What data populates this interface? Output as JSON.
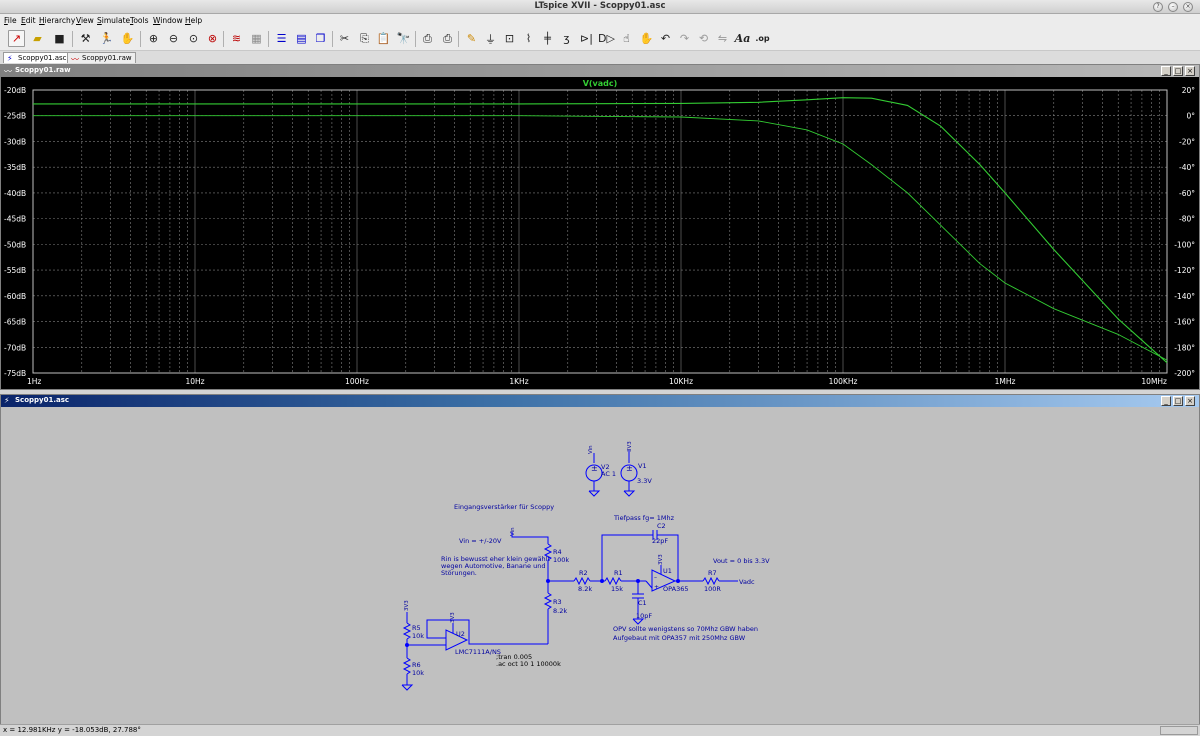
{
  "window": {
    "title": "LTspice XVII - Scoppy01.asc"
  },
  "menu": [
    "File",
    "Edit",
    "Hierarchy",
    "View",
    "Simulate",
    "Tools",
    "Window",
    "Help"
  ],
  "toolbar_icons": [
    "new-schematic-icon",
    "open-icon",
    "save-icon",
    "control-panel-icon",
    "run-icon",
    "halt-icon",
    "zoom-in-icon",
    "zoom-out-icon",
    "pan-icon",
    "zoom-fit-icon",
    "autorange-icon",
    "undo-zoom-icon",
    "tile-horizontal-icon",
    "tile-vertical-icon",
    "cascade-icon",
    "cut-icon",
    "copy-icon",
    "paste-icon",
    "find-icon",
    "print-icon",
    "print-setup-icon",
    "pencil-icon",
    "ground-icon",
    "label-net-icon",
    "resistor-icon",
    "capacitor-icon",
    "inductor-icon",
    "diode-icon",
    "component-icon",
    "move-icon",
    "drag-icon",
    "undo-icon",
    "redo-icon",
    "rotate-icon",
    "mirror-icon",
    "text-icon",
    "spice-directive-icon"
  ],
  "tabs": [
    {
      "label": "Scoppy01.asc",
      "icon": "schematic-icon"
    },
    {
      "label": "Scoppy01.raw",
      "icon": "waveform-icon"
    }
  ],
  "plot_window": {
    "title": "Scoppy01.raw"
  },
  "schematic_window": {
    "title": "Scoppy01.asc"
  },
  "status": {
    "text": "x = 12.981KHz   y = -18.053dB, 27.788°"
  },
  "colors": {
    "trace": "#33cc33",
    "plot_bg": "#000000",
    "grid": "#808080",
    "wire": "#0000ff",
    "text": "#0000a0",
    "schematic_bg": "#c0c0c0"
  },
  "chart_data": {
    "type": "line",
    "title": "V(vadc)",
    "x_scale": "log",
    "xlim": [
      1,
      10000000
    ],
    "x_ticks": [
      "1Hz",
      "10Hz",
      "100Hz",
      "1KHz",
      "10KHz",
      "100KHz",
      "1MHz",
      "10MHz"
    ],
    "y_left": {
      "label": "dB",
      "ylim": [
        -75,
        -20
      ],
      "ticks": [
        "-20dB",
        "-25dB",
        "-30dB",
        "-35dB",
        "-40dB",
        "-45dB",
        "-50dB",
        "-55dB",
        "-60dB",
        "-65dB",
        "-70dB",
        "-75dB"
      ]
    },
    "y_right": {
      "label": "°",
      "ylim": [
        -200,
        20
      ],
      "ticks": [
        "20°",
        "0°",
        "-20°",
        "-40°",
        "-60°",
        "-80°",
        "-100°",
        "-120°",
        "-140°",
        "-160°",
        "-180°",
        "-200°"
      ]
    },
    "grid": true,
    "series": [
      {
        "name": "V(vadc)",
        "axis": "left",
        "quantity": "magnitude (dB)",
        "x": [
          1,
          10,
          100,
          1000,
          10000,
          30000,
          60000,
          100000,
          150000,
          250000,
          400000,
          700000,
          1000000,
          2000000,
          5000000,
          10000000
        ],
        "y": [
          -22.7,
          -22.7,
          -22.7,
          -22.7,
          -22.6,
          -22.4,
          -21.9,
          -21.5,
          -21.6,
          -23.0,
          -27.0,
          -34.5,
          -40.0,
          -51.0,
          -64.5,
          -73.0
        ]
      },
      {
        "name": "V(vadc)",
        "axis": "right",
        "quantity": "phase (°)",
        "x": [
          1,
          10,
          100,
          1000,
          10000,
          30000,
          60000,
          100000,
          150000,
          250000,
          400000,
          700000,
          1000000,
          2000000,
          5000000,
          10000000
        ],
        "y": [
          0,
          0,
          0,
          0,
          -1,
          -4,
          -11,
          -22,
          -38,
          -60,
          -85,
          -115,
          -130,
          -150,
          -170,
          -190
        ]
      }
    ]
  },
  "schematic": {
    "labels": {
      "v2_name": "V2",
      "v2_value": "AC 1",
      "v1_name": "V1",
      "v1_value": "3.3V",
      "vin_net": "Vin",
      "v3_net": "3V3",
      "vin_net2": "Vin",
      "title": "Eingangsverstärker für Scoppy",
      "vin_range": "Vin = +/-20V",
      "rin_note_1": "Rin is bewusst eher klein gewählt",
      "rin_note_2": "wegen Automotive, Banane und",
      "rin_note_3": "Störungen.",
      "r4": "R4",
      "r4v": "100k",
      "r3": "R3",
      "r3v": "8.2k",
      "r2": "R2",
      "r2v": "8.2k",
      "r1": "R1",
      "r1v": "15k",
      "c2": "C2",
      "c2v": "22pF",
      "c1": "C1",
      "c1v": "10pF",
      "u1": "U1",
      "u1v": "OPA365",
      "u2": "U2",
      "u2v": "LMC7111A/NS",
      "r5": "R5",
      "r5v": "10k",
      "r6": "R6",
      "r6v": "10k",
      "r7": "R7",
      "r7v": "100R",
      "vadc": "Vadc",
      "tiefpass": "Tiefpass fg= 1Mhz",
      "vout": "Vout = 0 bis 3.3V",
      "opv_1": "OPV sollte wenigstens so 70Mhz GBW haben",
      "opv_2": "Aufgebaut mit OPA357 mit 250Mhz GBW",
      "tran": ";tran 0.005",
      "ac": ".ac oct 10 1 10000k",
      "u1_3v3": "3V3",
      "u2_3v3": "3V3",
      "r5_3v3": "3V3"
    }
  }
}
